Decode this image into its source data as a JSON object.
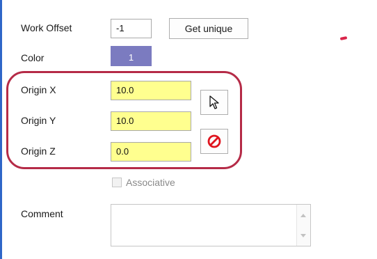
{
  "form": {
    "work_offset": {
      "label": "Work Offset",
      "value": "-1",
      "button": "Get unique"
    },
    "color": {
      "label": "Color",
      "value": "1",
      "swatch_color": "#7b7bc0"
    },
    "origin_x": {
      "label": "Origin X",
      "value": "10.0"
    },
    "origin_y": {
      "label": "Origin Y",
      "value": "10.0"
    },
    "origin_z": {
      "label": "Origin Z",
      "value": "0.0"
    },
    "associative": {
      "label": "Associative",
      "checked": false,
      "enabled": false
    },
    "comment": {
      "label": "Comment",
      "value": ""
    }
  },
  "icons": {
    "select_point": "cursor-arrow-icon",
    "clear_origin": "no-entry-icon"
  },
  "colors": {
    "highlight": "#b52b47",
    "input_highlight": "#ffff8f",
    "accent_border": "#2f66c8"
  }
}
